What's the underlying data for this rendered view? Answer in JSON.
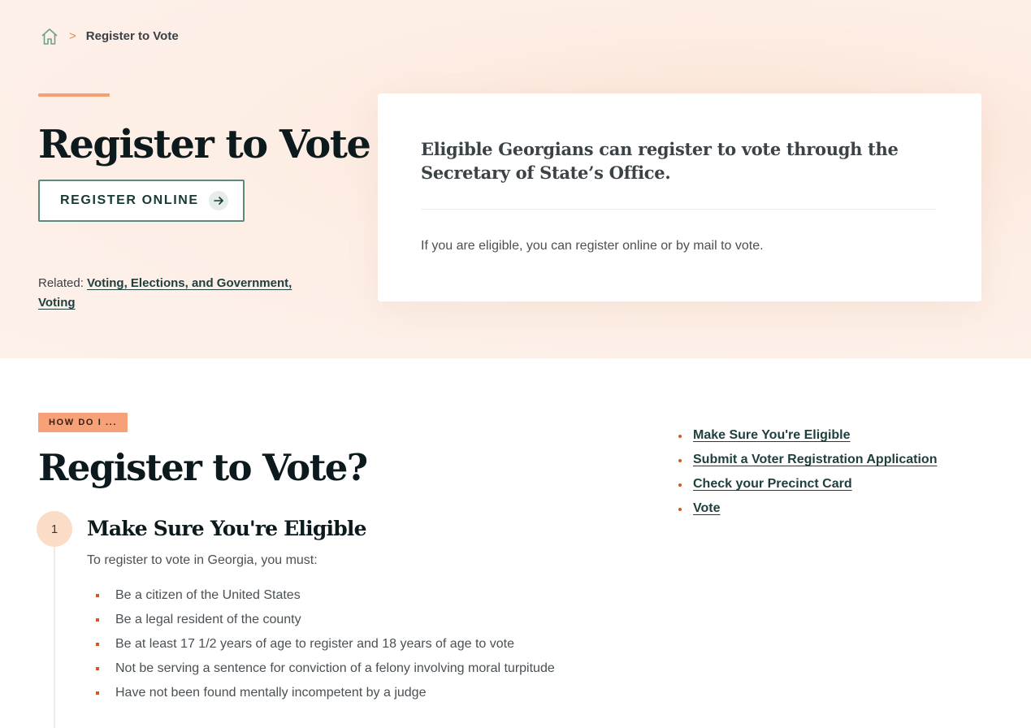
{
  "breadcrumb": {
    "home_icon": "home-icon",
    "separator": ">",
    "current": "Register to Vote"
  },
  "hero": {
    "title": "Register to Vote",
    "button_label": "REGISTER ONLINE",
    "button_icon": "arrow-right-icon",
    "related_label": "Related:",
    "related_links": [
      "Voting, Elections, and Government,",
      "Voting"
    ]
  },
  "card": {
    "lead": "Eligible Georgians can register to vote through the Secretary of State’s Office.",
    "body": "If you are eligible, you can register online or by mail to vote."
  },
  "howto": {
    "tag": "HOW DO I ...",
    "title": "Register to Vote?",
    "steps": [
      {
        "number": "1",
        "title": "Make Sure You're Eligible",
        "intro": "To register to vote in Georgia, you must:",
        "items": [
          "Be a citizen of the United States",
          "Be a legal resident of the county",
          "Be at least 17 1/2 years of age to register and 18 years of age to vote",
          "Not be serving a sentence for conviction of a felony involving moral turpitude",
          "Have not been found mentally incompetent by a judge"
        ]
      }
    ]
  },
  "toc": {
    "items": [
      "Make Sure You're Eligible",
      "Submit a Voter Registration Application",
      "Check your Precinct Card",
      "Vote"
    ]
  },
  "colors": {
    "hero_bg": "#fdeee5",
    "accent": "#f4a070",
    "tag_bg": "#f6a178",
    "bullet": "#d4572a",
    "link": "#1e3f3e",
    "button_border": "#5c8a7c",
    "step_circle": "#fbdcc7"
  }
}
